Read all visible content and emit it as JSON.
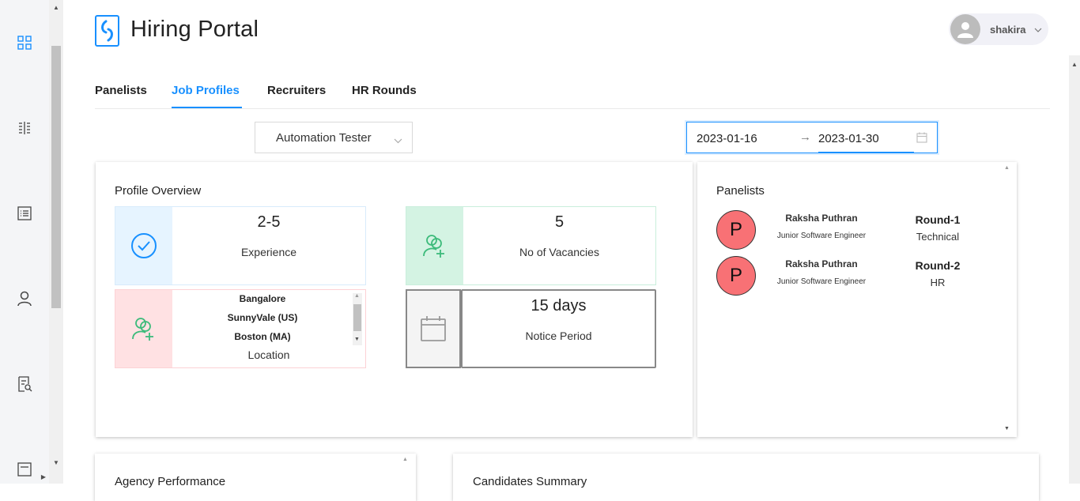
{
  "app": {
    "title": "Hiring Portal"
  },
  "user": {
    "name": "shakira"
  },
  "nav": {
    "rail_icons": [
      "dashboard-icon",
      "columns-icon",
      "list-icon",
      "user-icon",
      "report-icon",
      "list-icon"
    ]
  },
  "tabs": [
    {
      "label": "Panelists",
      "active": false
    },
    {
      "label": "Job Profiles",
      "active": true
    },
    {
      "label": "Recruiters",
      "active": false
    },
    {
      "label": "HR Rounds",
      "active": false
    }
  ],
  "filters": {
    "job_profile": "Automation Tester",
    "date_start": "2023-01-16",
    "date_end": "2023-01-30",
    "arrow": "→"
  },
  "overview": {
    "title": "Profile Overview",
    "experience": {
      "value": "2-5",
      "label": "Experience"
    },
    "vacancies": {
      "value": "5",
      "label": "No of Vacancies"
    },
    "location": {
      "items": [
        "Bangalore",
        "SunnyVale (US)",
        "Boston (MA)"
      ],
      "label": "Location"
    },
    "notice": {
      "value": "15 days",
      "label": "Notice Period"
    }
  },
  "panelists": {
    "title": "Panelists",
    "rows": [
      {
        "initial": "P",
        "name": "Raksha Puthran",
        "role": "Junior Software Engineer",
        "round": "Round-1",
        "type": "Technical"
      },
      {
        "initial": "P",
        "name": "Raksha Puthran",
        "role": "Junior Software Engineer",
        "round": "Round-2",
        "type": "HR"
      }
    ]
  },
  "bottom": {
    "agency_title": "Agency Performance",
    "candidates_title": "Candidates Summary"
  },
  "colors": {
    "accent": "#1890ff",
    "experience_tile": "#e6f4ff",
    "vacancy_tile": "#d4f3e3",
    "location_tile": "#ffe1e3",
    "notice_tile": "#f4f4f4",
    "avatar": "#f87175"
  }
}
